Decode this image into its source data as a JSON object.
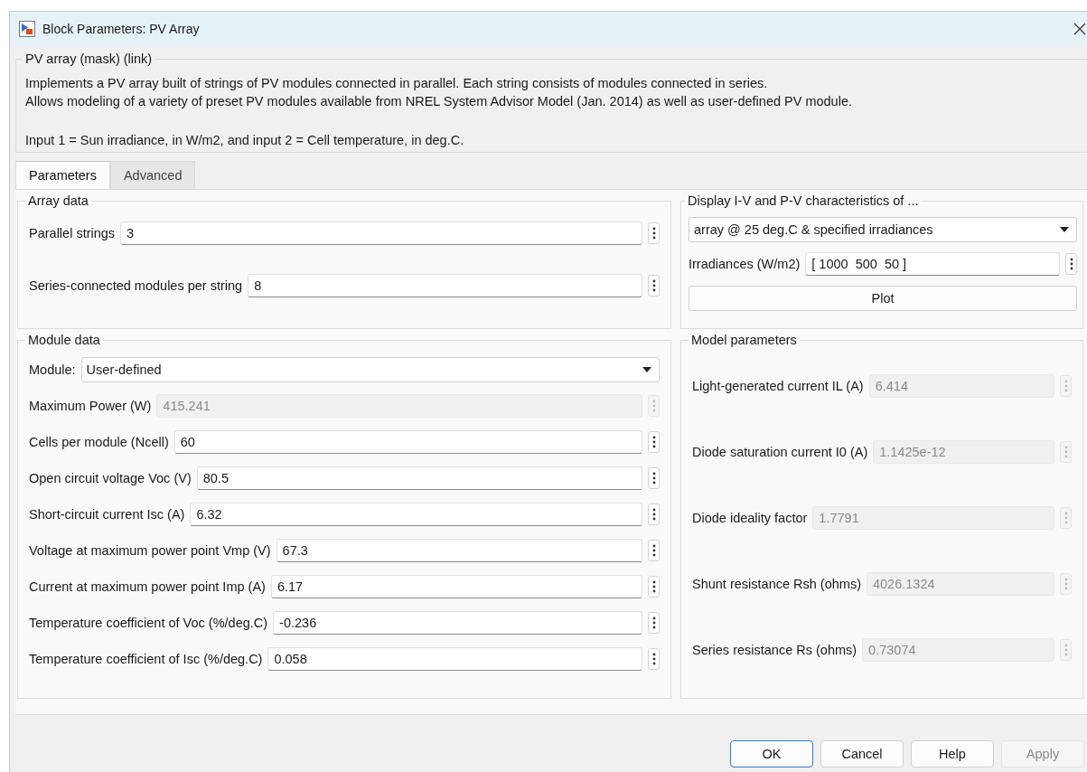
{
  "window": {
    "title": "Block Parameters: PV Array"
  },
  "description": {
    "title": "PV array (mask) (link)",
    "paragraphs": [
      [
        "Implements a PV array built of strings of PV modules connected in parallel. Each string consists of modules connected in series.",
        "Allows modeling of a variety of preset PV modules available from NREL System Advisor Model (Jan. 2014) as well as user-defined PV module."
      ],
      [
        "Input 1 = Sun irradiance, in W/m2, and input 2 = Cell temperature, in deg.C."
      ]
    ]
  },
  "tabs": [
    {
      "label": "Parameters",
      "selected": true
    },
    {
      "label": "Advanced",
      "selected": false
    }
  ],
  "array_data": {
    "title": "Array data",
    "fields": [
      {
        "label": "Parallel strings",
        "value": "3",
        "disabled": false
      },
      {
        "label": "Series-connected modules per string",
        "value": "8",
        "disabled": false
      }
    ]
  },
  "module_data": {
    "title": "Module data",
    "module": {
      "label": "Module:",
      "value": "User-defined"
    },
    "fields": [
      {
        "label": "Maximum Power (W)",
        "value": "415.241",
        "disabled": true
      },
      {
        "label": "Cells per module (Ncell)",
        "value": "60",
        "disabled": false
      },
      {
        "label": "Open circuit voltage  Voc (V)",
        "value": "80.5",
        "disabled": false
      },
      {
        "label": "Short-circuit current Isc (A)",
        "value": "6.32",
        "disabled": false
      },
      {
        "label": "Voltage at maximum power point Vmp (V)",
        "value": "67.3",
        "disabled": false
      },
      {
        "label": "Current at maximum power point Imp (A)",
        "value": "6.17",
        "disabled": false
      },
      {
        "label": "Temperature coefficient of Voc (%/deg.C)",
        "value": "-0.236",
        "disabled": false
      },
      {
        "label": "Temperature coefficient of Isc (%/deg.C)",
        "value": "0.058",
        "disabled": false
      }
    ]
  },
  "display": {
    "title": "Display  I-V and P-V characteristics of ...",
    "selection": "array @ 25 deg.C & specified irradiances",
    "irradiances": {
      "label": "Irradiances (W/m2)",
      "value": "[ 1000  500  50 ]",
      "disabled": false
    },
    "plot_button": "Plot"
  },
  "model_parameters": {
    "title": "Model parameters",
    "fields": [
      {
        "label": "Light-generated current IL (A)",
        "value": "6.414",
        "disabled": true
      },
      {
        "label": "Diode saturation current I0 (A)",
        "value": "1.1425e-12",
        "disabled": true
      },
      {
        "label": "Diode ideality factor",
        "value": "1.7791",
        "disabled": true
      },
      {
        "label": "Shunt resistance Rsh (ohms)",
        "value": "4026.1324",
        "disabled": true
      },
      {
        "label": "Series resistance Rs (ohms)",
        "value": "0.73074",
        "disabled": true
      }
    ]
  },
  "buttons": [
    {
      "label": "OK",
      "default": true,
      "disabled": false
    },
    {
      "label": "Cancel",
      "default": false,
      "disabled": false
    },
    {
      "label": "Help",
      "default": false,
      "disabled": false
    },
    {
      "label": "Apply",
      "default": false,
      "disabled": true
    }
  ]
}
